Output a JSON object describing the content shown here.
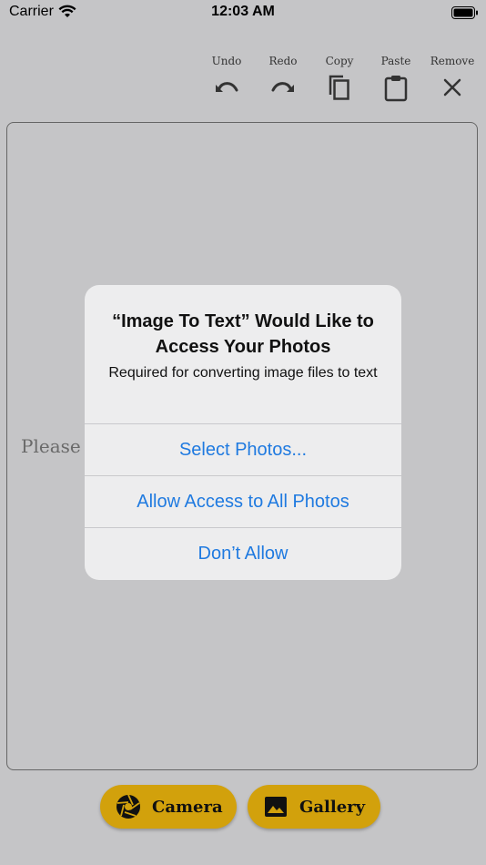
{
  "status_bar": {
    "carrier": "Carrier",
    "time": "12:03 AM"
  },
  "toolbar": {
    "items": [
      {
        "label": "Undo",
        "icon": "undo-icon"
      },
      {
        "label": "Redo",
        "icon": "redo-icon"
      },
      {
        "label": "Copy",
        "icon": "copy-icon"
      },
      {
        "label": "Paste",
        "icon": "paste-icon"
      },
      {
        "label": "Remove",
        "icon": "close-icon"
      }
    ]
  },
  "editor": {
    "placeholder_visible": "Please i"
  },
  "actions": {
    "camera_label": "Camera",
    "camera_icon": "camera-aperture-icon",
    "gallery_label": "Gallery",
    "gallery_icon": "image-icon",
    "button_color": "#d2a10c"
  },
  "alert": {
    "title": "“Image To Text” Would Like to Access Your Photos",
    "message": "Required for converting image files to text",
    "buttons": [
      "Select Photos...",
      "Allow Access to All Photos",
      "Don’t Allow"
    ],
    "button_color": "#1f7ae0"
  }
}
